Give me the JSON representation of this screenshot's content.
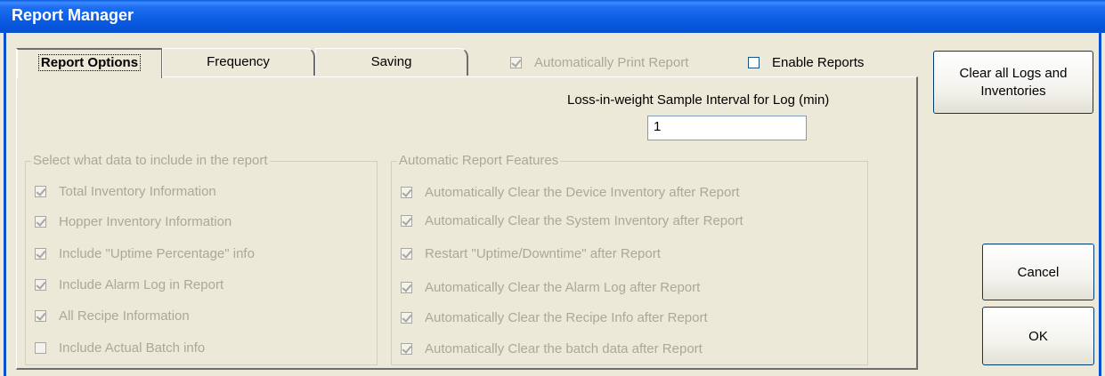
{
  "window": {
    "title": "Report Manager"
  },
  "tabs": [
    {
      "label": "Report Options",
      "active": true
    },
    {
      "label": "Frequency",
      "active": false
    },
    {
      "label": "Saving",
      "active": false
    }
  ],
  "top_options": {
    "auto_print": {
      "label": "Automatically Print Report",
      "checked": true,
      "enabled": false
    },
    "enable_reports": {
      "label": "Enable Reports",
      "checked": false,
      "enabled": true
    }
  },
  "sample_interval": {
    "label": "Loss-in-weight Sample Interval for Log (min)",
    "value": "1"
  },
  "data_group": {
    "title": "Select what data to include in the report",
    "items": [
      {
        "label": "Total Inventory Information",
        "checked": true
      },
      {
        "label": "Hopper Inventory Information",
        "checked": true
      },
      {
        "label": "Include \"Uptime Percentage\" info",
        "checked": true
      },
      {
        "label": "Include Alarm Log in Report",
        "checked": true
      },
      {
        "label": "All Recipe Information",
        "checked": true
      },
      {
        "label": "Include Actual Batch info",
        "checked": false
      }
    ]
  },
  "auto_group": {
    "title": "Automatic Report Features",
    "items": [
      {
        "label": "Automatically Clear the Device Inventory after Report",
        "checked": true
      },
      {
        "label": "Automatically Clear the System Inventory after Report",
        "checked": true
      },
      {
        "label": "Restart \"Uptime/Downtime\" after Report",
        "checked": true
      },
      {
        "label": "Automatically Clear the Alarm Log after Report",
        "checked": true
      },
      {
        "label": "Automatically Clear the Recipe Info after Report",
        "checked": true
      },
      {
        "label": "Automatically Clear the batch data after Report",
        "checked": true
      }
    ]
  },
  "buttons": {
    "clear_logs_line1": "Clear all Logs and",
    "clear_logs_line2": "Inventories",
    "cancel": "Cancel",
    "ok": "OK"
  },
  "colors": {
    "titlebar": "#0858e0",
    "face": "#ece9d8",
    "disabled_text": "#aca899"
  }
}
